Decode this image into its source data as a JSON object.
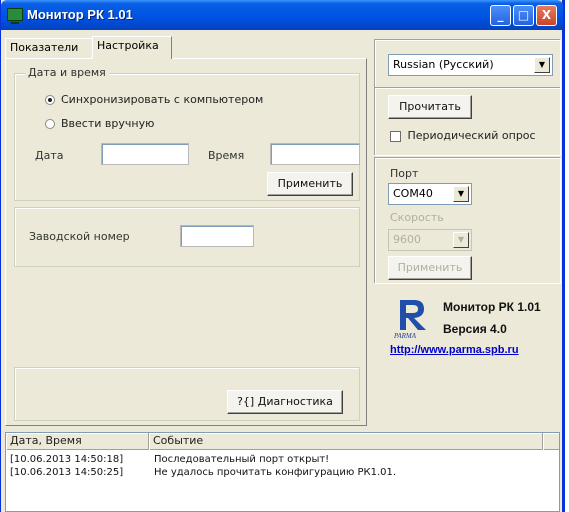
{
  "window": {
    "title": "Монитор РК 1.01",
    "controls": [
      "_",
      "□",
      "X"
    ]
  },
  "tabs": [
    {
      "label": "Показатели",
      "active": false
    },
    {
      "label": "Настройка",
      "active": true
    }
  ],
  "datetime_group": {
    "legend": "Дата и время",
    "radio_sync": "Синхронизировать с компьютером",
    "radio_manual": "Ввести вручную",
    "date_label": "Дата",
    "date_value": "",
    "time_label": "Время",
    "time_value": "",
    "apply_button": "Применить"
  },
  "serial_group": {
    "label": "Заводской номер",
    "value": ""
  },
  "diagnostics_button": "?{] Диагностика",
  "language": {
    "selected": "Russian (Русский)"
  },
  "read_panel": {
    "read_button": "Прочитать",
    "periodic_label": "Периодический опрос",
    "periodic_checked": false
  },
  "port_panel": {
    "port_label": "Порт",
    "port_value": "COM40",
    "speed_label": "Скорость",
    "speed_value": "9600",
    "apply_button": "Применить"
  },
  "about": {
    "logo_text": "PARMA",
    "title": "Монитор РК 1.01",
    "version": "Версия 4.0",
    "link": "http://www.parma.spb.ru"
  },
  "log": {
    "headers": [
      "Дата, Время",
      "Событие"
    ],
    "rows": [
      {
        "time": "[10.06.2013 14:50:18]",
        "event": "Последовательный порт открыт!"
      },
      {
        "time": "[10.06.2013 14:50:25]",
        "event": "Не удалось прочитать конфигурацию РК1.01."
      }
    ]
  },
  "colors": {
    "titlebar": "#0055e5",
    "window_bg": "#ece9d8",
    "link": "#0000cc",
    "logo_blue": "#1f4fa8"
  }
}
